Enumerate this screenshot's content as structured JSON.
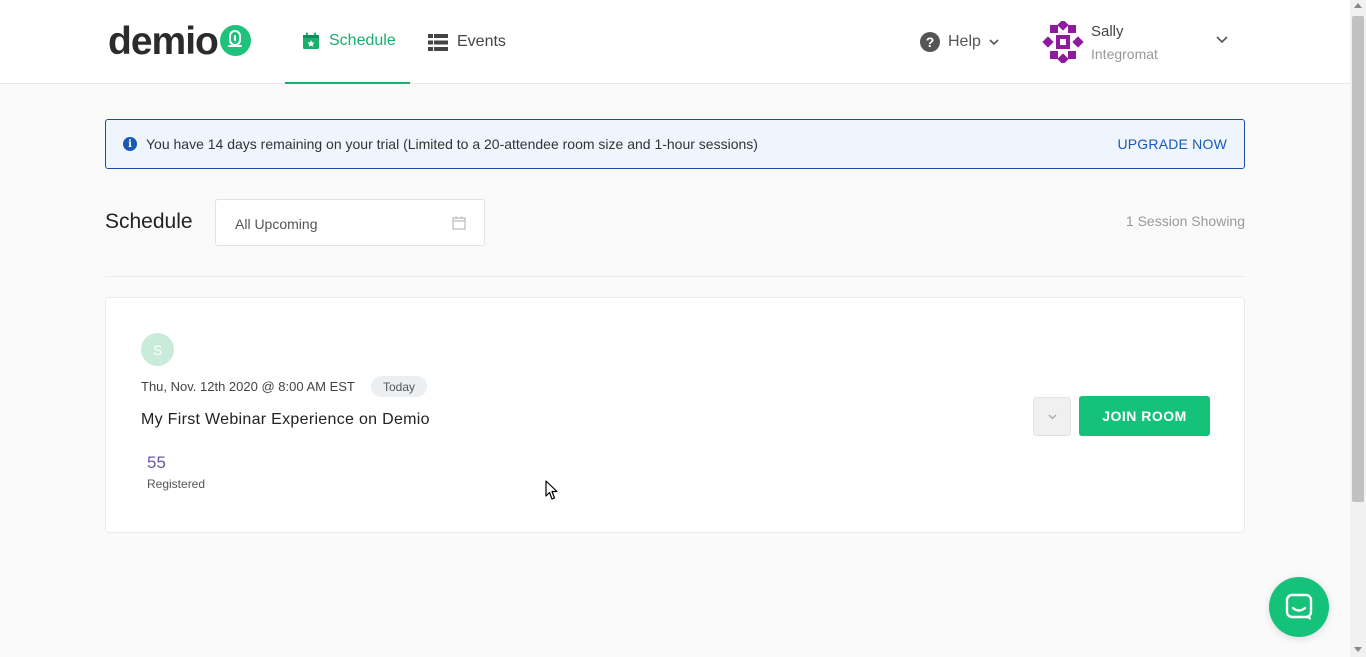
{
  "header": {
    "logo_text": "demio",
    "nav": {
      "schedule_label": "Schedule",
      "events_label": "Events"
    },
    "help_label": "Help",
    "user": {
      "name": "Sally",
      "org": "Integromat"
    }
  },
  "banner": {
    "message": "You have 14 days remaining on your trial (Limited to a 20-attendee room size and 1-hour sessions)",
    "action_label": "UPGRADE NOW"
  },
  "schedule": {
    "title": "Schedule",
    "filter_value": "All Upcoming",
    "session_count": "1 Session Showing"
  },
  "session": {
    "host_initial": "S",
    "date": "Thu, Nov. 12th 2020 @ 8:00 AM EST",
    "badge": "Today",
    "title": "My First Webinar Experience on Demio",
    "registered_count": "55",
    "registered_label": "Registered",
    "join_label": "JOIN ROOM"
  },
  "colors": {
    "brand_green": "#1aae6f",
    "button_green": "#14c27a",
    "banner_blue": "#1a58b8",
    "avatar_purple": "#8e1a9e"
  }
}
